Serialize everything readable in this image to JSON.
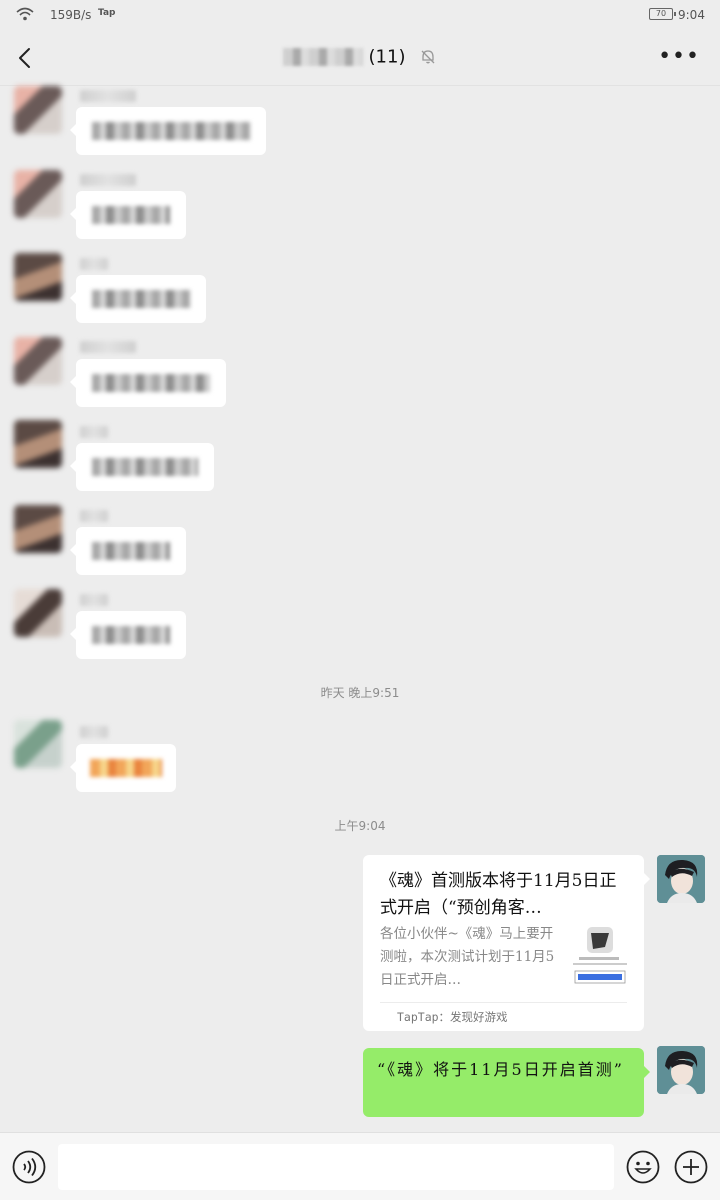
{
  "status_bar": {
    "speed": "159B/s",
    "app_badge": "Tap",
    "battery": "70",
    "time": "9:04"
  },
  "header": {
    "title_count": "(11)"
  },
  "timestamps": {
    "yesterday": "昨天 晚上9:51",
    "today": "上午9:04"
  },
  "shared_card": {
    "title": "《魂》首测版本将于11月5日正式开启（“预创角客…",
    "description": "各位小伙伴~《魂》马上要开测啦，本次测试计划于11月5日正式开启…",
    "source": "TapTap：发现好游戏"
  },
  "my_message": {
    "text": "“《魂》将于11月5日开启首测”"
  },
  "icons": {
    "back": "back-arrow-icon",
    "mute": "bell-off-icon",
    "more": "more-icon",
    "voice": "voice-icon",
    "emoji": "emoji-icon",
    "plus": "plus-icon"
  },
  "colors": {
    "background": "#ededed",
    "own_bubble": "#95ec69",
    "incoming_bubble": "#ffffff"
  }
}
